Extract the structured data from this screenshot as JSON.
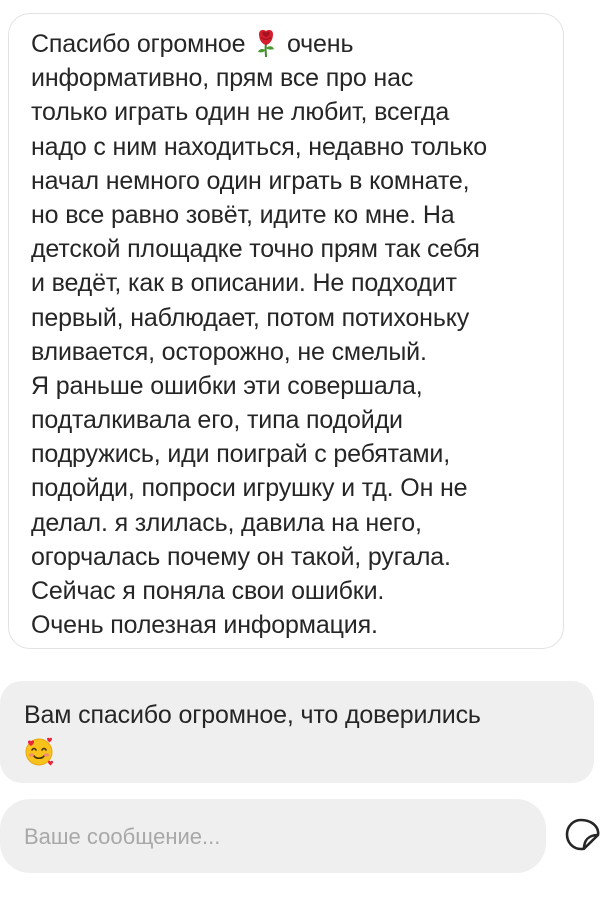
{
  "thread": {
    "incoming_message": {
      "lines": [
        {
          "before": "Спасибо огромное ",
          "after": " очень",
          "emoji": "rose-icon"
        },
        {
          "text": "информативно, прям все про нас"
        },
        {
          "text": "только играть один не любит, всегда"
        },
        {
          "text": "надо с ним находиться, недавно только"
        },
        {
          "text": "начал немного один играть в комнате,"
        },
        {
          "text": "но все равно зовёт, идите ко мне. На"
        },
        {
          "text": "детской площадке точно прям так себя"
        },
        {
          "text": "и ведёт, как в описании. Не подходит"
        },
        {
          "text": "первый, наблюдает, потом потихоньку"
        },
        {
          "text": "вливается, осторожно, не смелый."
        },
        {
          "text": "Я раньше ошибки эти совершала,"
        },
        {
          "text": "подталкивала его, типа подойди"
        },
        {
          "text": "подружись, иди поиграй с ребятами,"
        },
        {
          "text": "подойди, попроси игрушку и тд. Он не"
        },
        {
          "text": "делал. я злилась, давила на него,"
        },
        {
          "text": "огорчалась почему он такой, ругала."
        },
        {
          "text": "Сейчас я поняла свои ошибки."
        },
        {
          "text": "Очень полезная информация."
        }
      ],
      "border_color": "#e2e2e2"
    },
    "outgoing_message": {
      "text": "Вам спасибо огромное, что доверились",
      "emoji": "smiling-face-with-hearts-icon",
      "background": "#efefef"
    }
  },
  "composer": {
    "placeholder": "Ваше сообщение...",
    "value": "",
    "sticker_icon": "sticker-icon"
  }
}
